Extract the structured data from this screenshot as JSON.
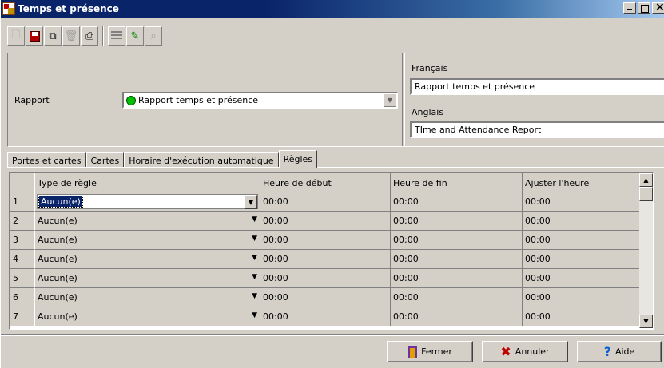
{
  "window": {
    "title": "Temps et présence"
  },
  "toolbar": {
    "icons": [
      "new-icon",
      "save-icon",
      "copy-icon",
      "delete-icon",
      "print-icon",
      "list-icon",
      "link-icon",
      "find-icon"
    ]
  },
  "rapport": {
    "label": "Rapport",
    "selected": "Rapport temps et présence"
  },
  "languages": {
    "fr_label": "Français",
    "fr_value": "Rapport temps et présence",
    "en_label": "Anglais",
    "en_value": "TIme and Attendance Report"
  },
  "tabs": [
    "Portes et cartes",
    "Cartes",
    "Horaire d'exécution automatique",
    "Règles"
  ],
  "active_tab": "Règles",
  "grid": {
    "columns": [
      "",
      "Type de règle",
      "Heure de début",
      "Heure de fin",
      "Ajuster l'heure"
    ],
    "rows": [
      {
        "num": "1",
        "type": "Aucun(e)",
        "start": "00:00",
        "end": "00:00",
        "adjust": "00:00"
      },
      {
        "num": "2",
        "type": "Aucun(e)",
        "start": "00:00",
        "end": "00:00",
        "adjust": "00:00"
      },
      {
        "num": "3",
        "type": "Aucun(e)",
        "start": "00:00",
        "end": "00:00",
        "adjust": "00:00"
      },
      {
        "num": "4",
        "type": "Aucun(e)",
        "start": "00:00",
        "end": "00:00",
        "adjust": "00:00"
      },
      {
        "num": "5",
        "type": "Aucun(e)",
        "start": "00:00",
        "end": "00:00",
        "adjust": "00:00"
      },
      {
        "num": "6",
        "type": "Aucun(e)",
        "start": "00:00",
        "end": "00:00",
        "adjust": "00:00"
      },
      {
        "num": "7",
        "type": "Aucun(e)",
        "start": "00:00",
        "end": "00:00",
        "adjust": "00:00"
      }
    ]
  },
  "footer": {
    "close_label": "Fermer",
    "cancel_label": "Annuler",
    "help_label": "Aide"
  },
  "colors": {
    "titlebar": "#0a246a",
    "face": "#d4d0c8",
    "selection": "#0a246a",
    "status_green": "#00c000"
  }
}
